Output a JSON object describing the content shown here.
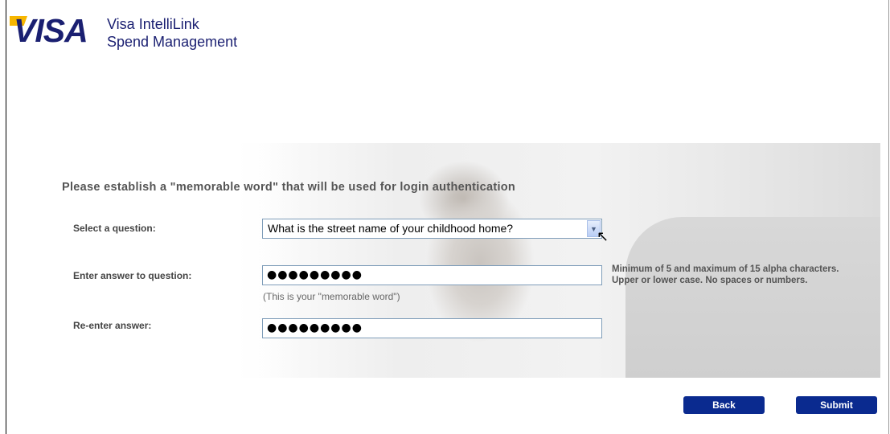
{
  "header": {
    "logo_text": "VISA",
    "app_name_line1": "Visa IntelliLink",
    "app_name_line2": "Spend Management"
  },
  "form": {
    "heading": "Please establish a \"memorable word\" that will be used for login authentication",
    "question_label": "Select a question:",
    "question_selected": "What is the street name of your childhood home?",
    "answer_label": "Enter answer to question:",
    "answer_value_masked": "●●●●●●●●●",
    "answer_hint": "(This is your \"memorable word\")",
    "reenter_label": "Re-enter answer:",
    "reenter_value_masked": "●●●●●●●●●",
    "rules_text": "Minimum of 5 and maximum of 15 alpha characters. Upper or lower case. No spaces or numbers."
  },
  "buttons": {
    "back": "Back",
    "submit": "Submit"
  },
  "icons": {
    "dropdown": "chevron-down-icon",
    "cursor": "mouse-pointer-icon"
  },
  "colors": {
    "brand_blue": "#1a1f71",
    "button_blue": "#0a2a8f",
    "brand_gold": "#f7b600"
  }
}
